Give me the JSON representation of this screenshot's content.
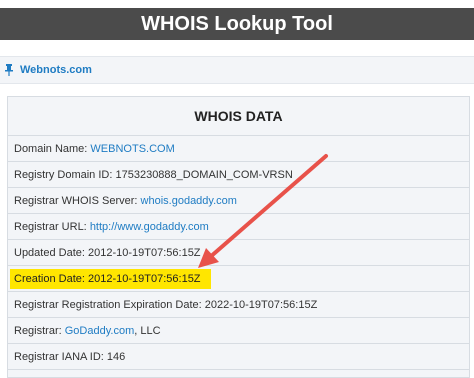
{
  "header": {
    "title": "WHOIS Lookup Tool"
  },
  "breadcrumb": {
    "link": "Webnots.com"
  },
  "panel": {
    "title": "WHOIS DATA"
  },
  "rows": [
    {
      "label": "Domain Name:",
      "value": "WEBNOTS.COM"
    },
    {
      "label": "Registry Domain ID:",
      "value": "1753230888_DOMAIN_COM-VRSN"
    },
    {
      "label": "Registrar WHOIS Server:",
      "value": "whois.godaddy.com"
    },
    {
      "label": "Registrar URL:",
      "value": "http://www.godaddy.com"
    },
    {
      "label": "Updated Date:",
      "value": "2012-10-19T07:56:15Z"
    },
    {
      "label": "Creation Date:",
      "value": "2012-10-19T07:56:15Z"
    },
    {
      "label": "Registrar Registration Expiration Date:",
      "value": "2022-10-19T07:56:15Z"
    },
    {
      "label": "Registrar:",
      "value": "GoDaddy.com",
      "suffix": ", LLC"
    },
    {
      "label": "Registrar IANA ID:",
      "value": "146"
    }
  ],
  "colors": {
    "header_bg": "#4b4b4b",
    "link": "#1f7cc3",
    "highlight": "#ffe600",
    "arrow": "#e8524a"
  },
  "icons": {
    "breadcrumb": "pin-icon"
  }
}
